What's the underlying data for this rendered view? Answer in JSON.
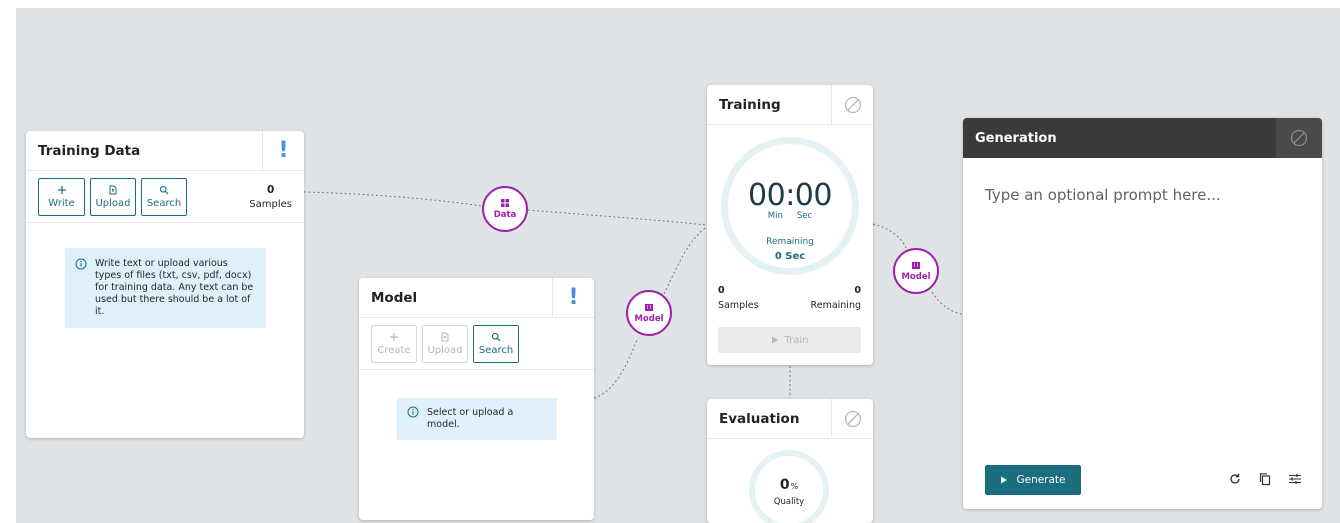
{
  "training_data": {
    "title": "Training Data",
    "buttons": {
      "write": "Write",
      "upload": "Upload",
      "search": "Search"
    },
    "samples_count": "0",
    "samples_label": "Samples",
    "info": "Write text or upload various types of files (txt, csv, pdf, docx) for training data. Any text can be used but there should be a lot of it."
  },
  "model": {
    "title": "Model",
    "buttons": {
      "create": "Create",
      "upload": "Upload",
      "search": "Search"
    },
    "info": "Select or upload a model."
  },
  "training": {
    "title": "Training",
    "timer": "00:00",
    "min_label": "Min",
    "sec_label": "Sec",
    "remaining_label": "Remaining",
    "remaining_value": "0 Sec",
    "samples_count": "0",
    "samples_label": "Samples",
    "remaining_count": "0",
    "remaining_count_label": "Remaining",
    "train_button": "Train"
  },
  "evaluation": {
    "title": "Evaluation",
    "quality_value": "0",
    "quality_unit": "%",
    "quality_label": "Quality"
  },
  "generation": {
    "title": "Generation",
    "prompt_placeholder": "Type an optional prompt here...",
    "generate_button": "Generate"
  },
  "nodes": {
    "data": "Data",
    "model_left": "Model",
    "model_right": "Model"
  },
  "colors": {
    "accent": "#1a6e80",
    "node": "#a020a8",
    "info_bg": "#dff0fb",
    "warning": "#4a90e2",
    "canvas": "#dfe3e6"
  }
}
